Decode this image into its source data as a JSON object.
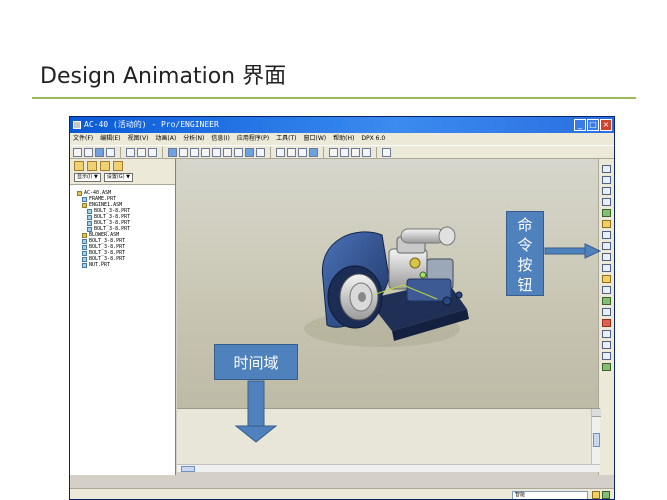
{
  "slide": {
    "title": "Design Animation 界面"
  },
  "window": {
    "title": "AC-40 (活动的) - Pro/ENGINEER",
    "buttons": {
      "minimize": "_",
      "maximize": "□",
      "close": "×"
    }
  },
  "menu": {
    "items": [
      "文件(F)",
      "编辑(E)",
      "视图(V)",
      "动画(A)",
      "分析(N)",
      "信息(I)",
      "应用程序(P)",
      "工具(T)",
      "窗口(W)",
      "帮助(H)",
      "DPX 6.0"
    ]
  },
  "navigator": {
    "display_button": "显示(I) ▼",
    "settings_button": "设置(G) ▼",
    "tree": [
      {
        "label": "AC-40.ASM",
        "type": "asm",
        "indent": 0
      },
      {
        "label": "FRAME.PRT",
        "type": "part",
        "indent": 1
      },
      {
        "label": "ENGINE1.ASM",
        "type": "asm",
        "indent": 1
      },
      {
        "label": "BOLT_3-8.PRT",
        "type": "part",
        "indent": 2
      },
      {
        "label": "BOLT_3-8.PRT",
        "type": "part",
        "indent": 2
      },
      {
        "label": "BOLT_3-8.PRT",
        "type": "part",
        "indent": 2
      },
      {
        "label": "BOLT_3-8.PRT",
        "type": "part",
        "indent": 2
      },
      {
        "label": "BLOWER.ASM",
        "type": "asm",
        "indent": 1
      },
      {
        "label": "BOLT_3-8.PRT",
        "type": "part",
        "indent": 1
      },
      {
        "label": "BOLT_3-8.PRT",
        "type": "part",
        "indent": 1
      },
      {
        "label": "BOLT_3-8.PRT",
        "type": "part",
        "indent": 1
      },
      {
        "label": "BOLT_3-8.PRT",
        "type": "part",
        "indent": 1
      },
      {
        "label": "NUT.PRT",
        "type": "part",
        "indent": 1
      }
    ]
  },
  "statusbar": {
    "selection_filter": "智能"
  },
  "callouts": {
    "command_buttons": "命\n令\n按\n钮",
    "time_domain": "时间域"
  },
  "colors": {
    "title_rule": "#9bbb59",
    "callout_fill": "#4f81bd",
    "model_blue": "#2e4e8a"
  },
  "icons": {
    "viewport_model": "engine-blower-assembly-3d"
  }
}
